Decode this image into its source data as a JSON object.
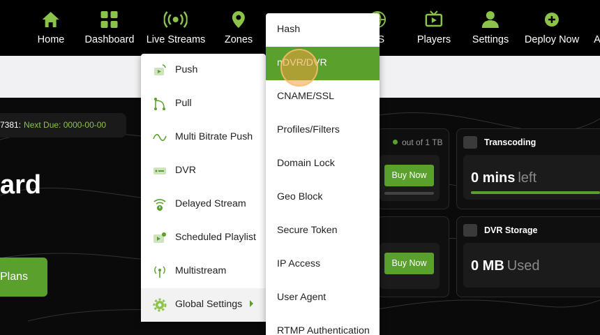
{
  "nav": {
    "items": [
      {
        "label": "Home",
        "icon": "home-icon"
      },
      {
        "label": "Dashboard",
        "icon": "dashboard-icon"
      },
      {
        "label": "Live Streams",
        "icon": "broadcast-icon"
      },
      {
        "label": "Zones",
        "icon": "location-pin-icon"
      },
      {
        "label": "NS",
        "icon": "globe-icon"
      },
      {
        "label": "Players",
        "icon": "tv-icon"
      },
      {
        "label": "Settings",
        "icon": "user-settings-icon"
      },
      {
        "label": "Deploy Now",
        "icon": "plus-circle-icon"
      },
      {
        "label": "A",
        "icon": "truncated-icon"
      }
    ]
  },
  "account": {
    "id_text": "7381:",
    "due_text": "Next Due: 0000-00-00"
  },
  "page": {
    "title_fragment": "ard",
    "plans_label": "Plans"
  },
  "cards": {
    "bandwidth": {
      "quota": "out of 1 TB",
      "buy_label": "Buy Now"
    },
    "storage": {
      "buy_label": "Buy Now"
    },
    "transcoding": {
      "title": "Transcoding",
      "value": "0 mins",
      "suffix": "left",
      "icon": "video-icon"
    },
    "dvr_storage": {
      "title": "DVR Storage",
      "value": "0 MB",
      "suffix": "Used",
      "icon": "drive-icon"
    }
  },
  "menu_live_streams": {
    "items": [
      {
        "label": "Push",
        "icon": "push-icon"
      },
      {
        "label": "Pull",
        "icon": "pull-icon"
      },
      {
        "label": "Multi Bitrate Push",
        "icon": "wave-icon"
      },
      {
        "label": "DVR",
        "icon": "dvr-icon"
      },
      {
        "label": "Delayed Stream",
        "icon": "wifi-alert-icon"
      },
      {
        "label": "Scheduled Playlist",
        "icon": "playlist-icon"
      },
      {
        "label": "Multistream",
        "icon": "antenna-icon"
      },
      {
        "label": "Global Settings",
        "icon": "gear-icon",
        "active": true
      }
    ]
  },
  "menu_global_settings": {
    "items": [
      {
        "label": "Hash"
      },
      {
        "label": "nDVR/DVR",
        "selected": true
      },
      {
        "label": "CNAME/SSL"
      },
      {
        "label": "Profiles/Filters"
      },
      {
        "label": "Domain Lock"
      },
      {
        "label": "Geo Block"
      },
      {
        "label": "Secure Token"
      },
      {
        "label": "IP Access"
      },
      {
        "label": "User Agent"
      },
      {
        "label": "RTMP Authentication"
      }
    ]
  },
  "colors": {
    "accent": "#5aa02c",
    "nav_bg": "#000000",
    "menu_bg": "#ffffff"
  }
}
